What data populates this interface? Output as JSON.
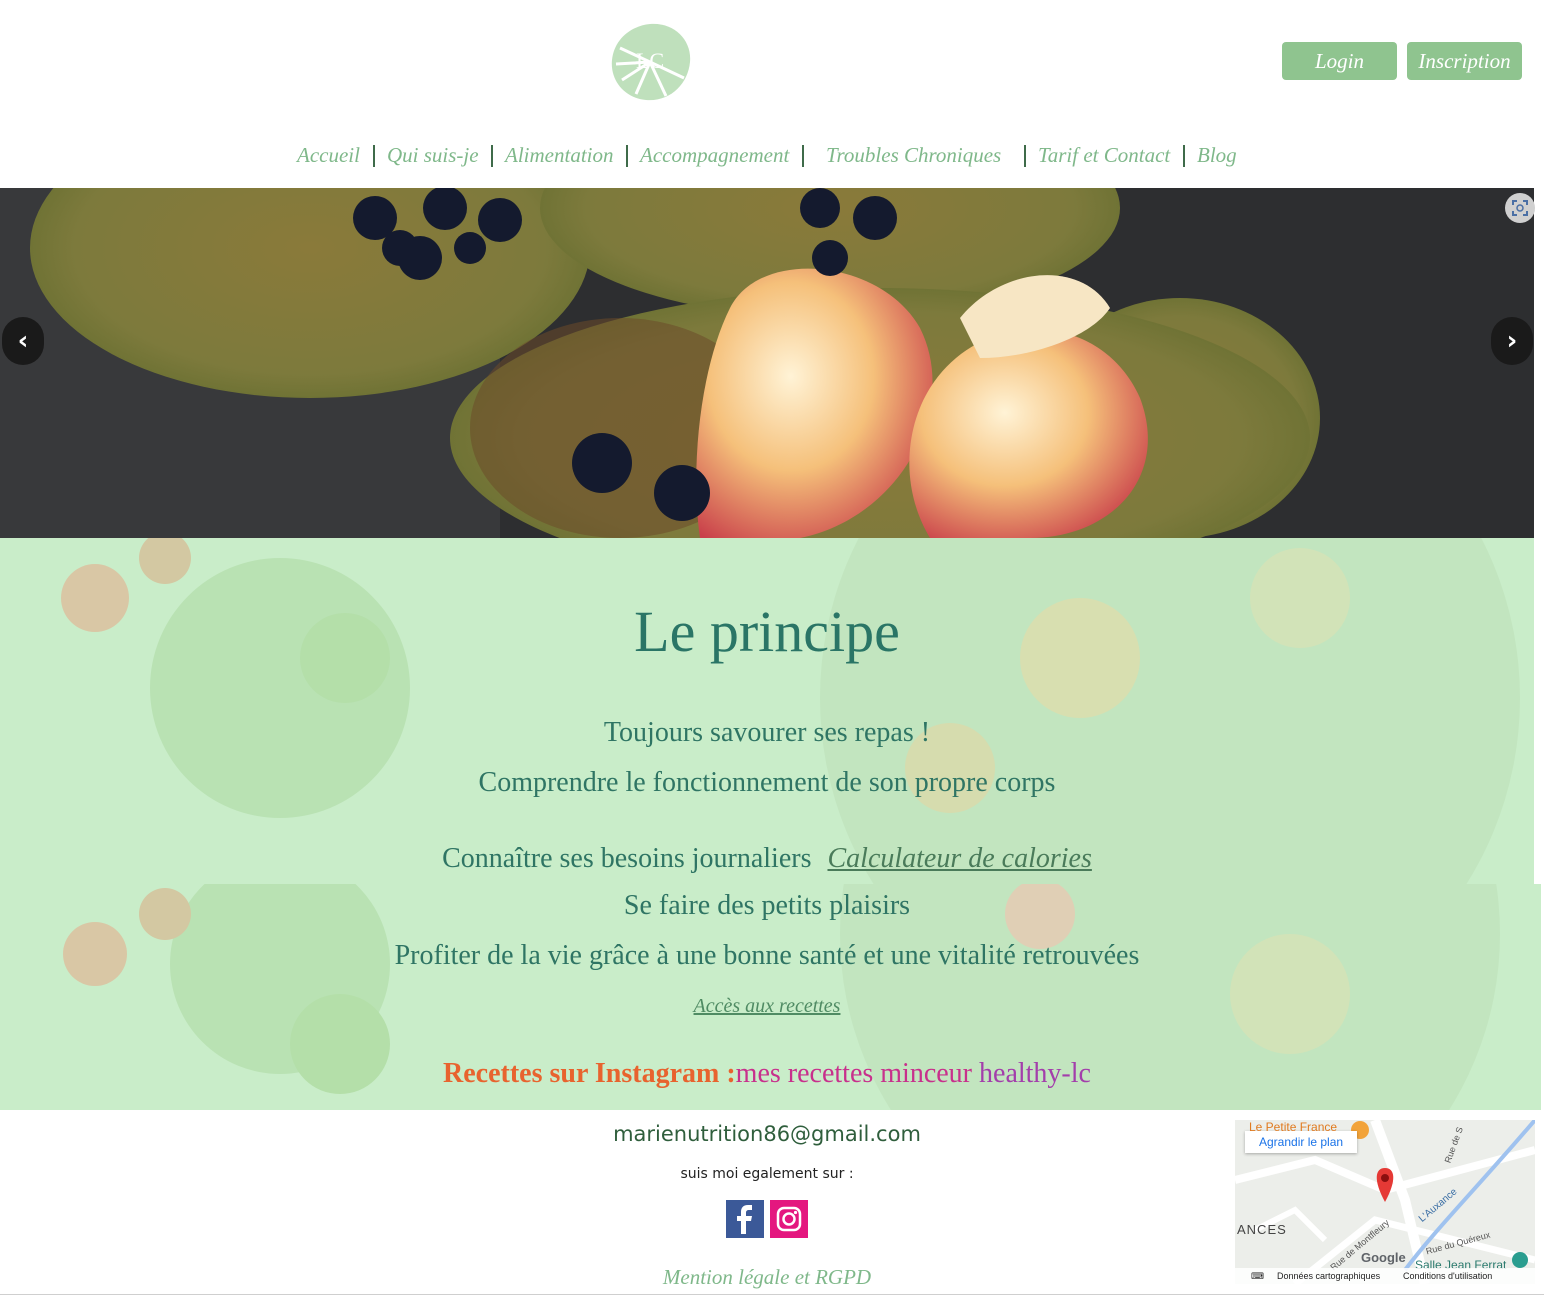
{
  "header": {
    "login_label": "Login",
    "signup_label": "Inscription",
    "brand_color": "#8fc48f"
  },
  "nav": {
    "items": [
      {
        "label": "Accueil"
      },
      {
        "label": "Qui suis-je"
      },
      {
        "label": "Alimentation"
      },
      {
        "label": "Accompagnement"
      },
      {
        "label": "Troubles Chroniques"
      },
      {
        "label": "Tarif et Contact"
      },
      {
        "label": "Blog"
      }
    ],
    "text_color": "#7fb88a"
  },
  "hero": {
    "prev_arrow": "‹",
    "next_arrow": "›",
    "fullscreen_icon": "fullscreen-icon"
  },
  "principle": {
    "title": "Le principe",
    "line1": "Toujours savourer ses repas !",
    "line2": "Comprendre le fonctionnement de son propre corps",
    "line3": "Connaître ses besoins journaliers",
    "calculator_link": "Calculateur de calories",
    "line4": "Se faire des petits plaisirs",
    "line5": "Profiter de la vie grâce à une bonne santé et une vitalité retrouvées",
    "recipes_link": "Accès aux recettes",
    "instagram_label": "Recettes sur Instagram :",
    "instagram_account1": "mes recettes minceur",
    "instagram_account2": "healthy-lc"
  },
  "footer": {
    "email": "marienutrition86@gmail.com",
    "follow_text": "suis moi egalement sur :",
    "social": [
      "facebook-icon",
      "instagram-icon"
    ],
    "legal_link": "Mention légale et RGPD"
  },
  "map": {
    "enlarge_label": "Agrandir le plan",
    "poi_top": "Le Petite France",
    "place_label": "ANCES",
    "street1": "Rue de S",
    "street2": "L'Auxance",
    "street3": "Rue de Montfleury",
    "street4": "Rue du Quéreux",
    "poi_bottom": "Salle Jean Ferrat",
    "google_label": "Google",
    "footer_data": "Données cartographiques",
    "footer_terms": "Conditions d'utilisation"
  }
}
